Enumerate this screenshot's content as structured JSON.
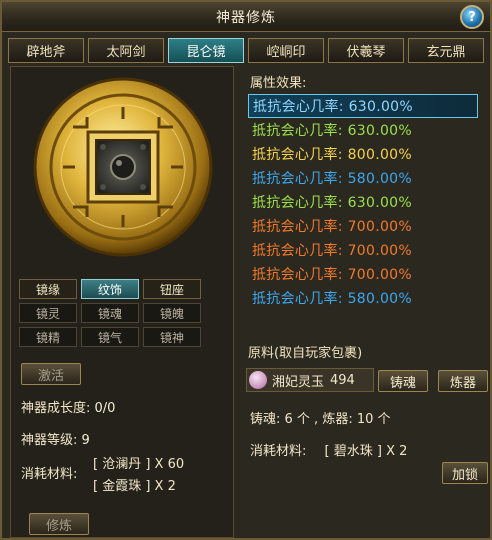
{
  "window": {
    "title": "神器修炼",
    "help_label": "?"
  },
  "tabs": [
    {
      "label": "辟地斧",
      "active": false
    },
    {
      "label": "太阿剑",
      "active": false
    },
    {
      "label": "昆仑镜",
      "active": true
    },
    {
      "label": "崆峒印",
      "active": false
    },
    {
      "label": "伏羲琴",
      "active": false
    },
    {
      "label": "玄元鼎",
      "active": false
    }
  ],
  "left": {
    "sub_tabs": [
      [
        "镜缘",
        "纹饰",
        "钮座"
      ],
      [
        "镜灵",
        "镜魂",
        "镜魄"
      ],
      [
        "镜精",
        "镜气",
        "镜神"
      ]
    ],
    "selected_sub_tab": "纹饰",
    "activate_label": "激活",
    "growth_label": "神器成长度:",
    "growth_value": "0/0",
    "level_label": "神器等级:",
    "level_value": "9",
    "materials_label": "消耗材料:",
    "materials": [
      "[ 沧澜丹 ] X 60",
      "[ 金霞珠 ] X 2"
    ],
    "cultivate_label": "修炼"
  },
  "right": {
    "attr_title": "属性效果:",
    "attributes": [
      {
        "text": "抵抗会心几率: 630.00%",
        "color": "#8fd6ff",
        "selected": true
      },
      {
        "text": "抵抗会心几率: 630.00%",
        "color": "#9be04b",
        "selected": false
      },
      {
        "text": "抵抗会心几率: 800.00%",
        "color": "#f4d24a",
        "selected": false
      },
      {
        "text": "抵抗会心几率: 580.00%",
        "color": "#3ba8f0",
        "selected": false
      },
      {
        "text": "抵抗会心几率: 630.00%",
        "color": "#9be04b",
        "selected": false
      },
      {
        "text": "抵抗会心几率: 700.00%",
        "color": "#f07a2a",
        "selected": false
      },
      {
        "text": "抵抗会心几率: 700.00%",
        "color": "#f07a2a",
        "selected": false
      },
      {
        "text": "抵抗会心几率: 700.00%",
        "color": "#f07a2a",
        "selected": false
      },
      {
        "text": "抵抗会心几率: 580.00%",
        "color": "#3ba8f0",
        "selected": false
      }
    ],
    "material_header": "原料(取自玩家包裹)",
    "item_name": "湘妃灵玉",
    "item_count": "494",
    "cast_soul_label": "铸魂",
    "forge_label": "炼器",
    "counts_text": "铸魂: 6 个 , 炼器: 10 个",
    "consume_label": "消耗材料:",
    "consume_item": "[ 碧水珠 ] X 2",
    "lock_label": "加锁"
  }
}
